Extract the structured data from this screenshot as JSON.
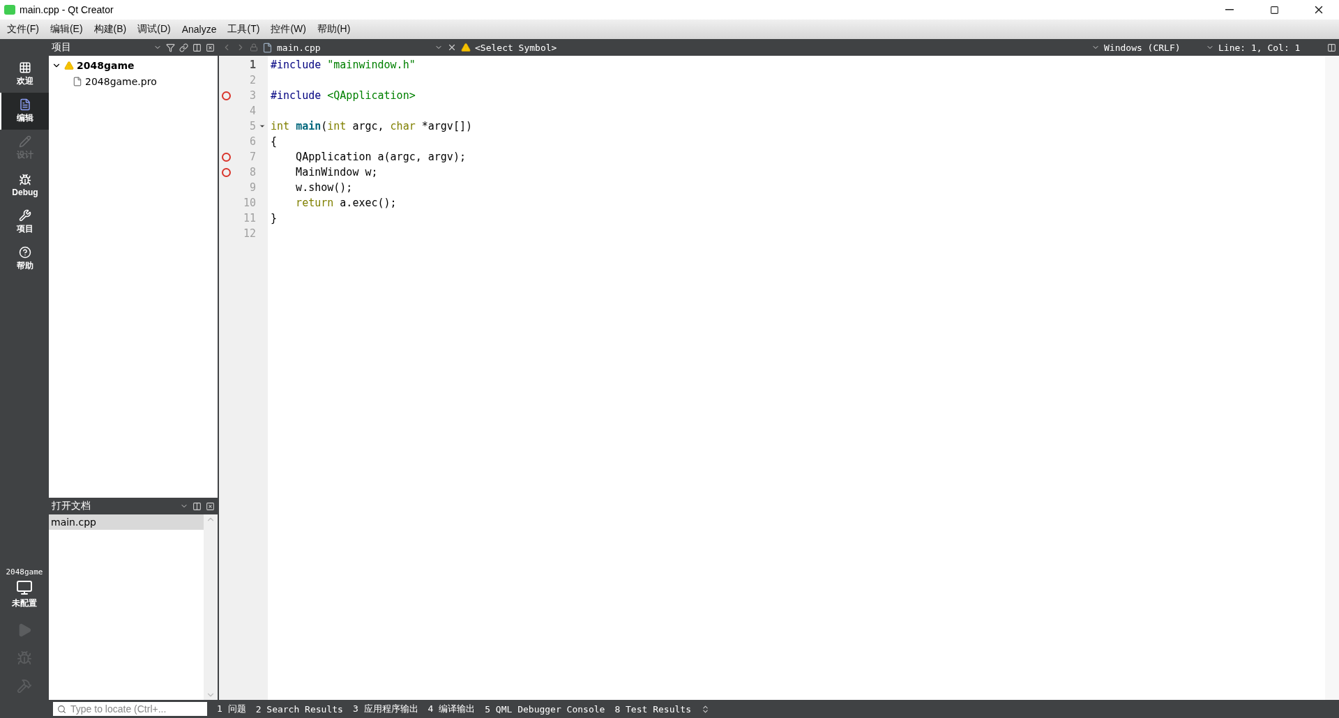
{
  "window": {
    "title": "main.cpp - Qt Creator"
  },
  "menu": [
    "文件(F)",
    "编辑(E)",
    "构建(B)",
    "调试(D)",
    "Analyze",
    "工具(T)",
    "控件(W)",
    "帮助(H)"
  ],
  "modes": [
    {
      "kind": "welcome",
      "label": "欢迎",
      "selected": false,
      "disabled": false
    },
    {
      "kind": "edit",
      "label": "编辑",
      "selected": true,
      "disabled": false
    },
    {
      "kind": "design",
      "label": "设计",
      "selected": false,
      "disabled": true
    },
    {
      "kind": "debug",
      "label": "Debug",
      "selected": false,
      "disabled": false
    },
    {
      "kind": "projects",
      "label": "项目",
      "selected": false,
      "disabled": false
    },
    {
      "kind": "help",
      "label": "帮助",
      "selected": false,
      "disabled": false
    }
  ],
  "target": {
    "project": "2048game",
    "config": "未配置"
  },
  "projects_panel": {
    "title": "项目",
    "tree": [
      {
        "name": "2048game",
        "expanded": true,
        "warning": true,
        "children": [
          {
            "name": "2048game.pro"
          }
        ]
      }
    ]
  },
  "open_documents": {
    "title": "打开文档",
    "items": [
      {
        "name": "main.cpp",
        "selected": true
      }
    ]
  },
  "editor": {
    "file": "main.cpp",
    "symbol": "<Select Symbol>",
    "encoding": "Windows (CRLF)",
    "position": "Line: 1, Col: 1",
    "lines": [
      {
        "number": "1",
        "current": true,
        "breakpoint": false,
        "fold": false,
        "tokens": [
          {
            "text": "#include ",
            "kind": "pre"
          },
          {
            "text": "\"mainwindow.h\"",
            "kind": "string"
          }
        ]
      },
      {
        "number": "2",
        "current": false,
        "breakpoint": false,
        "fold": false
      },
      {
        "number": "3",
        "current": false,
        "breakpoint": true,
        "fold": false,
        "tokens": [
          {
            "text": "#include ",
            "kind": "pre"
          },
          {
            "text": "<QApplication>",
            "kind": "string"
          }
        ]
      },
      {
        "number": "4",
        "current": false,
        "breakpoint": false,
        "fold": false
      },
      {
        "number": "5",
        "current": false,
        "breakpoint": false,
        "fold": true,
        "tokens": [
          {
            "text": "int ",
            "kind": "keyword"
          },
          {
            "text": "main",
            "kind": "function"
          },
          {
            "text": "(",
            "kind": "plain"
          },
          {
            "text": "int ",
            "kind": "keyword"
          },
          {
            "text": "argc, ",
            "kind": "plain"
          },
          {
            "text": "char ",
            "kind": "keyword"
          },
          {
            "text": "*argv[])",
            "kind": "plain"
          }
        ]
      },
      {
        "number": "6",
        "current": false,
        "breakpoint": false,
        "fold": false,
        "tokens": [
          {
            "text": "{",
            "kind": "plain"
          }
        ]
      },
      {
        "number": "7",
        "current": false,
        "breakpoint": true,
        "fold": false,
        "tokens": [
          {
            "text": "    QApplication a(argc, argv);",
            "kind": "plain"
          }
        ]
      },
      {
        "number": "8",
        "current": false,
        "breakpoint": true,
        "fold": false,
        "tokens": [
          {
            "text": "    MainWindow w;",
            "kind": "plain"
          }
        ]
      },
      {
        "number": "9",
        "current": false,
        "breakpoint": false,
        "fold": false,
        "tokens": [
          {
            "text": "    w.show();",
            "kind": "plain"
          }
        ]
      },
      {
        "number": "10",
        "current": false,
        "breakpoint": false,
        "fold": false,
        "tokens": [
          {
            "text": "    return ",
            "kind": "keyword"
          },
          {
            "text": "a.exec();",
            "kind": "plain"
          }
        ]
      },
      {
        "number": "11",
        "current": false,
        "breakpoint": false,
        "fold": false,
        "tokens": [
          {
            "text": "}",
            "kind": "plain"
          }
        ]
      },
      {
        "number": "12",
        "current": false,
        "breakpoint": false,
        "fold": false
      }
    ]
  },
  "status_bar": {
    "locator_placeholder": "Type to locate (Ctrl+...",
    "panes": [
      "1 问题",
      "2 Search Results",
      "3 应用程序输出",
      "4 编译输出",
      "5 QML Debugger Console",
      "8 Test Results"
    ]
  }
}
